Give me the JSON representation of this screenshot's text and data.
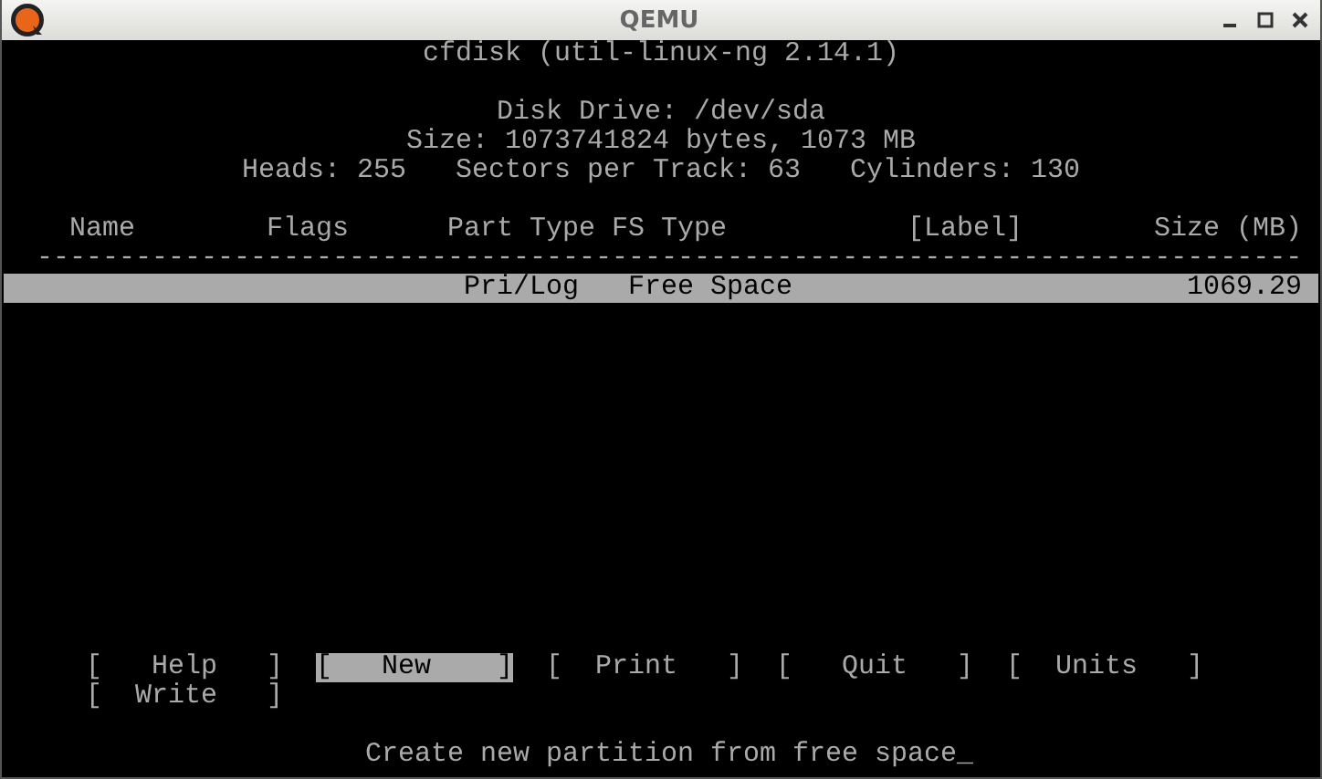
{
  "window": {
    "title": "QEMU"
  },
  "terminal": {
    "program": "cfdisk (util-linux-ng 2.14.1)",
    "info": [
      "Disk Drive: /dev/sda",
      "Size: 1073741824 bytes, 1073 MB",
      "Heads: 255   Sectors per Track: 63   Cylinders: 130"
    ],
    "table": {
      "columns": [
        "Name",
        "Flags",
        "Part Type",
        "FS Type",
        "[Label]",
        "Size (MB)"
      ],
      "separator": "-----------------------------------------------------------------------------",
      "rows": [
        {
          "part_type": "Pri/Log",
          "fs_type": "Free Space",
          "size": "1069.29",
          "selected": true
        }
      ]
    },
    "menu": [
      {
        "label": "[   Help   ]",
        "selected": false
      },
      {
        "label": "[   New    ]",
        "selected": true
      },
      {
        "label": "[  Print   ]",
        "selected": false
      },
      {
        "label": "[   Quit   ]",
        "selected": false
      },
      {
        "label": "[  Units   ]",
        "selected": false
      },
      {
        "label": "[  Write   ]",
        "selected": false
      }
    ],
    "status": "Create new partition from free space_"
  }
}
